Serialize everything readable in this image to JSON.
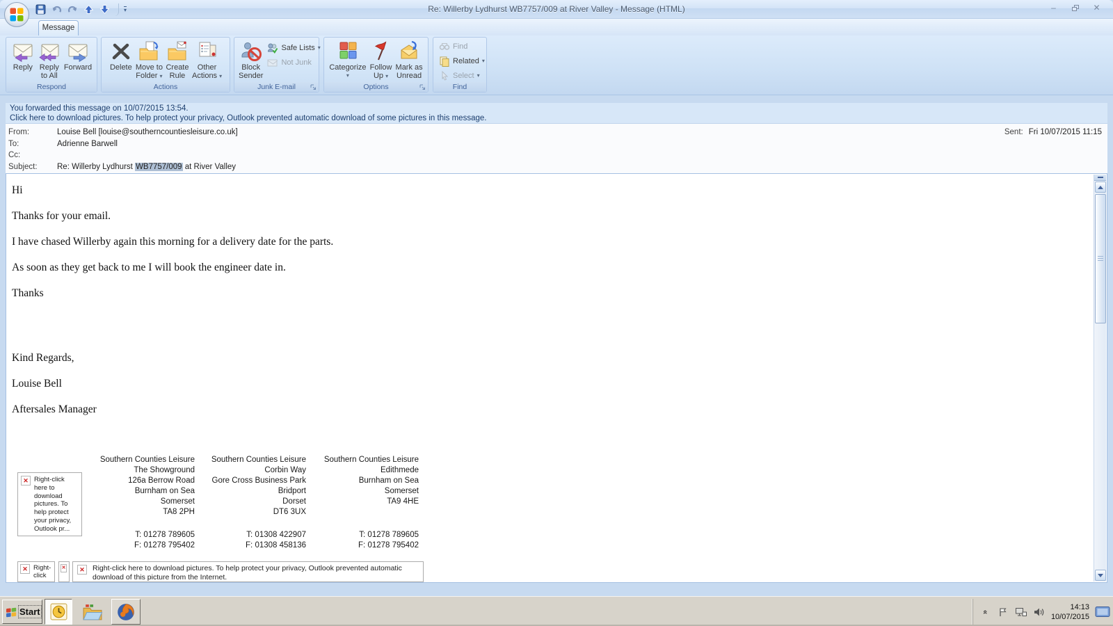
{
  "icons": {
    "dropdown": "▾",
    "minimize": "–",
    "close": "✕",
    "redx": "✕",
    "chevron": "«"
  },
  "window": {
    "title": "Re: Willerby Lydhurst WB7757/009 at River Valley  -  Message (HTML)"
  },
  "ribbon": {
    "tab_message": "Message",
    "respond": {
      "label": "Respond",
      "reply": "Reply",
      "reply_all_l1": "Reply",
      "reply_all_l2": "to All",
      "forward": "Forward"
    },
    "actions": {
      "label": "Actions",
      "delete": "Delete",
      "move_l1": "Move to",
      "move_l2": "Folder",
      "create_l1": "Create",
      "create_l2": "Rule",
      "other_l1": "Other",
      "other_l2": "Actions"
    },
    "junk": {
      "label": "Junk E-mail",
      "block_l1": "Block",
      "block_l2": "Sender",
      "safe_lists": "Safe Lists",
      "not_junk": "Not Junk"
    },
    "options": {
      "label": "Options",
      "categorize": "Categorize",
      "follow_l1": "Follow",
      "follow_l2": "Up",
      "mark_l1": "Mark as",
      "mark_l2": "Unread"
    },
    "find": {
      "label": "Find",
      "find": "Find",
      "related": "Related",
      "select": "Select"
    }
  },
  "infobar": {
    "line1": "You forwarded this message on 10/07/2015 13:54.",
    "line2": "Click here to download pictures. To help protect your privacy, Outlook prevented automatic download of some pictures in this message."
  },
  "header": {
    "from_label": "From:",
    "from_value": "Louise Bell [louise@southerncountiesleisure.co.uk]",
    "sent_label": "Sent:",
    "sent_value": "Fri 10/07/2015 11:15",
    "to_label": "To:",
    "to_value": "Adrienne Barwell",
    "cc_label": "Cc:",
    "cc_value": "",
    "subject_label": "Subject:",
    "subject_pre": "Re: Willerby Lydhurst ",
    "subject_highlight": "WB7757/009",
    "subject_post": " at River Valley"
  },
  "body": {
    "paragraphs": [
      "Hi",
      "Thanks for your email.",
      "I have chased Willerby again this morning for a delivery date for the parts.",
      "As soon as they get back to me I will book the engineer date in.",
      "Thanks"
    ],
    "closing": [
      "Kind Regards,",
      "Louise Bell",
      "Aftersales Manager"
    ]
  },
  "signature": {
    "columns": [
      {
        "lines": [
          "Southern Counties Leisure",
          "The Showground",
          "126a Berrow Road",
          "Burnham on Sea",
          "Somerset",
          "TA8 2PH"
        ],
        "tel": "T: 01278 789605",
        "fax": "F: 01278 795402"
      },
      {
        "lines": [
          "Southern Counties Leisure",
          "Corbin Way",
          "Gore Cross Business Park",
          "Bridport",
          "Dorset",
          "DT6 3UX"
        ],
        "tel": "T: 01308 422907",
        "fax": "F: 01308 458136"
      },
      {
        "lines": [
          "Southern Counties Leisure",
          "Edithmede",
          "Burnham on Sea",
          "Somerset",
          "TA9 4HE"
        ],
        "tel": "T: 01278 789605",
        "fax": "F: 01278 795402"
      }
    ],
    "placeholder_side": "Right-click here to download pictures.  To help protect your privacy, Outlook pr...",
    "placeholder_small": "Right-click",
    "placeholder_wide": "Right-click here to download pictures.  To help protect your privacy, Outlook prevented automatic download of this picture from the Internet."
  },
  "taskbar": {
    "start": "Start",
    "clock_time": "14:13",
    "clock_date": "10/07/2015"
  }
}
